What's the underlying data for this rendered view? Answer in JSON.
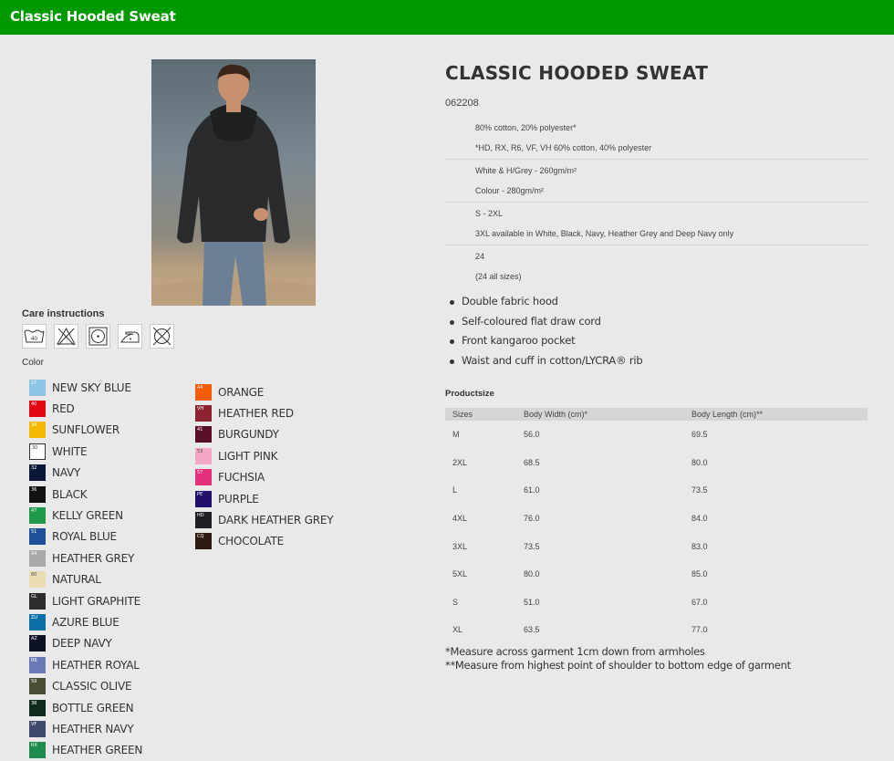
{
  "header": {
    "title": "Classic Hooded Sweat"
  },
  "care": {
    "title": "Care instructions",
    "icons": [
      {
        "name": "wash-40-icon",
        "label": "40"
      },
      {
        "name": "no-bleach-icon"
      },
      {
        "name": "tumble-dry-low-icon"
      },
      {
        "name": "iron-low-icon"
      },
      {
        "name": "no-dry-clean-icon"
      }
    ]
  },
  "color": {
    "title": "Color",
    "column1": [
      {
        "code": "1T",
        "name": "NEW SKY BLUE",
        "hex": "#8ec4e4"
      },
      {
        "code": "40",
        "name": "RED",
        "hex": "#e30613"
      },
      {
        "code": "34",
        "name": "SUNFLOWER",
        "hex": "#f5b800"
      },
      {
        "code": "30",
        "name": "WHITE",
        "hex": "#ffffff"
      },
      {
        "code": "32",
        "name": "NAVY",
        "hex": "#0b1736"
      },
      {
        "code": "36",
        "name": "BLACK",
        "hex": "#111111"
      },
      {
        "code": "47",
        "name": "KELLY GREEN",
        "hex": "#1e9a4a"
      },
      {
        "code": "51",
        "name": "ROYAL BLUE",
        "hex": "#1d4f9a"
      },
      {
        "code": "94",
        "name": "HEATHER GREY",
        "hex": "#a9a9a9"
      },
      {
        "code": "60",
        "name": "NATURAL",
        "hex": "#ecdcb4"
      },
      {
        "code": "GL",
        "name": "LIGHT GRAPHITE",
        "hex": "#2c2c2c"
      },
      {
        "code": "ZU",
        "name": "AZURE BLUE",
        "hex": "#0a6fa6"
      },
      {
        "code": "AZ",
        "name": "DEEP NAVY",
        "hex": "#0c1124"
      },
      {
        "code": "R6",
        "name": "HEATHER ROYAL",
        "hex": "#6a78b8"
      },
      {
        "code": "59",
        "name": "CLASSIC OLIVE",
        "hex": "#4b4d36"
      },
      {
        "code": "38",
        "name": "BOTTLE GREEN",
        "hex": "#0f2b1c"
      },
      {
        "code": "VF",
        "name": "HEATHER NAVY",
        "hex": "#3e4a6e"
      },
      {
        "code": "RX",
        "name": "HEATHER GREEN",
        "hex": "#1f8a4e"
      }
    ],
    "column2": [
      {
        "code": "44",
        "name": "ORANGE",
        "hex": "#f25c05"
      },
      {
        "code": "VH",
        "name": "HEATHER RED",
        "hex": "#8c2331"
      },
      {
        "code": "41",
        "name": "BURGUNDY",
        "hex": "#5a0f26"
      },
      {
        "code": "53",
        "name": "LIGHT PINK",
        "hex": "#f2a8c4"
      },
      {
        "code": "57",
        "name": "FUCHSIA",
        "hex": "#e5307c"
      },
      {
        "code": "PE",
        "name": "PURPLE",
        "hex": "#22106a"
      },
      {
        "code": "HD",
        "name": "DARK HEATHER GREY",
        "hex": "#1e1f24"
      },
      {
        "code": "CQ",
        "name": "CHOCOLATE",
        "hex": "#2d1a12"
      }
    ]
  },
  "product": {
    "title": "CLASSIC HOODED SWEAT",
    "code": "062208",
    "specs": [
      [
        "80% cotton, 20% polyester*",
        "*HD, RX, R6, VF, VH 60% cotton, 40% polyester"
      ],
      [
        "White & H/Grey - 260gm/m²",
        "Colour - 280gm/m²"
      ],
      [
        "S - 2XL",
        "3XL available in White, Black, Navy, Heather Grey and Deep Navy only"
      ],
      [
        "24",
        "(24 all sizes)"
      ]
    ],
    "features": [
      "Double fabric hood",
      "Self-coloured flat draw cord",
      "Front kangaroo pocket",
      "Waist and cuff in cotton/LYCRA® rib"
    ]
  },
  "productsize": {
    "title": "Productsize",
    "headers": [
      "Sizes",
      "Body Width (cm)*",
      "Body Length (cm)**"
    ],
    "rows": [
      [
        "M",
        "56.0",
        "69.5"
      ],
      [
        "2XL",
        "68.5",
        "80.0"
      ],
      [
        "L",
        "61.0",
        "73.5"
      ],
      [
        "4XL",
        "76.0",
        "84.0"
      ],
      [
        "3XL",
        "73.5",
        "83.0"
      ],
      [
        "5XL",
        "80.0",
        "85.0"
      ],
      [
        "S",
        "51.0",
        "67.0"
      ],
      [
        "XL",
        "63.5",
        "77.0"
      ]
    ],
    "notes": [
      "*Measure across garment 1cm down from armholes",
      "**Measure from highest point of shoulder to bottom edge of garment"
    ]
  }
}
